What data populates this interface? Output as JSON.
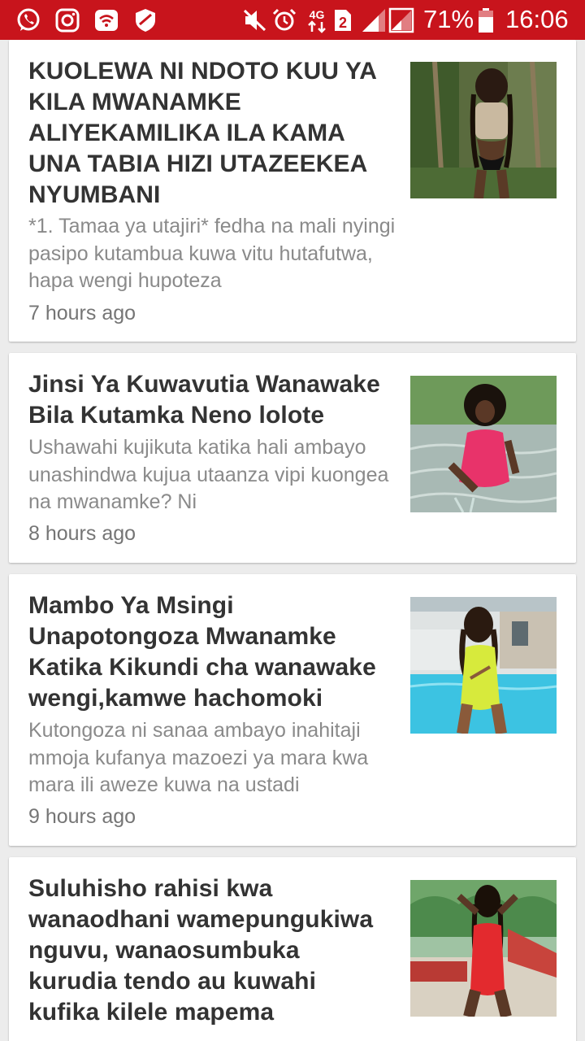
{
  "status_bar": {
    "battery_percent": "71%",
    "time": "16:06",
    "network": "4G",
    "sim_slot": "2",
    "background_color": "#c8141c",
    "left_icons": [
      "whatsapp-icon",
      "instagram-icon",
      "wifi-hotspot-icon",
      "shield-icon"
    ],
    "right_icons": [
      "mute-icon",
      "alarm-icon",
      "network-4g-icon",
      "sim-2-icon",
      "signal-icon",
      "signal-icon",
      "battery-icon"
    ]
  },
  "feed": {
    "articles": [
      {
        "title": "KUOLEWA NI NDOTO KUU YA KILA MWANAMKE ALIYEKAMILIKA ILA KAMA UNA TABIA HIZI UTAZEEKEA NYUMBANI",
        "excerpt": "*1. Tamaa ya utajiri* fedha na mali nyingi pasipo kutambua kuwa vitu hutafutwa, hapa wengi hupoteza",
        "time": "7 hours ago"
      },
      {
        "title": "Jinsi Ya Kuwavutia Wanawake Bila Kutamka Neno lolote",
        "excerpt": "Ushawahi kujikuta katika hali ambayo unashindwa kujua utaanza vipi kuongea na mwanamke? Ni",
        "time": "8 hours ago"
      },
      {
        "title": "Mambo Ya Msingi Unapotongoza Mwanamke Katika Kikundi cha wanawake wengi,kamwe hachomoki",
        "excerpt": "Kutongoza ni sanaa ambayo inahitaji mmoja kufanya mazoezi ya mara kwa mara ili aweze kuwa na ustadi",
        "time": "9 hours ago"
      },
      {
        "title": "Suluhisho rahisi kwa wanaodhani wamepungukiwa nguvu, wanaosumbuka kurudia tendo au kuwahi kufika kilele mapema",
        "excerpt": "",
        "time": ""
      }
    ]
  }
}
